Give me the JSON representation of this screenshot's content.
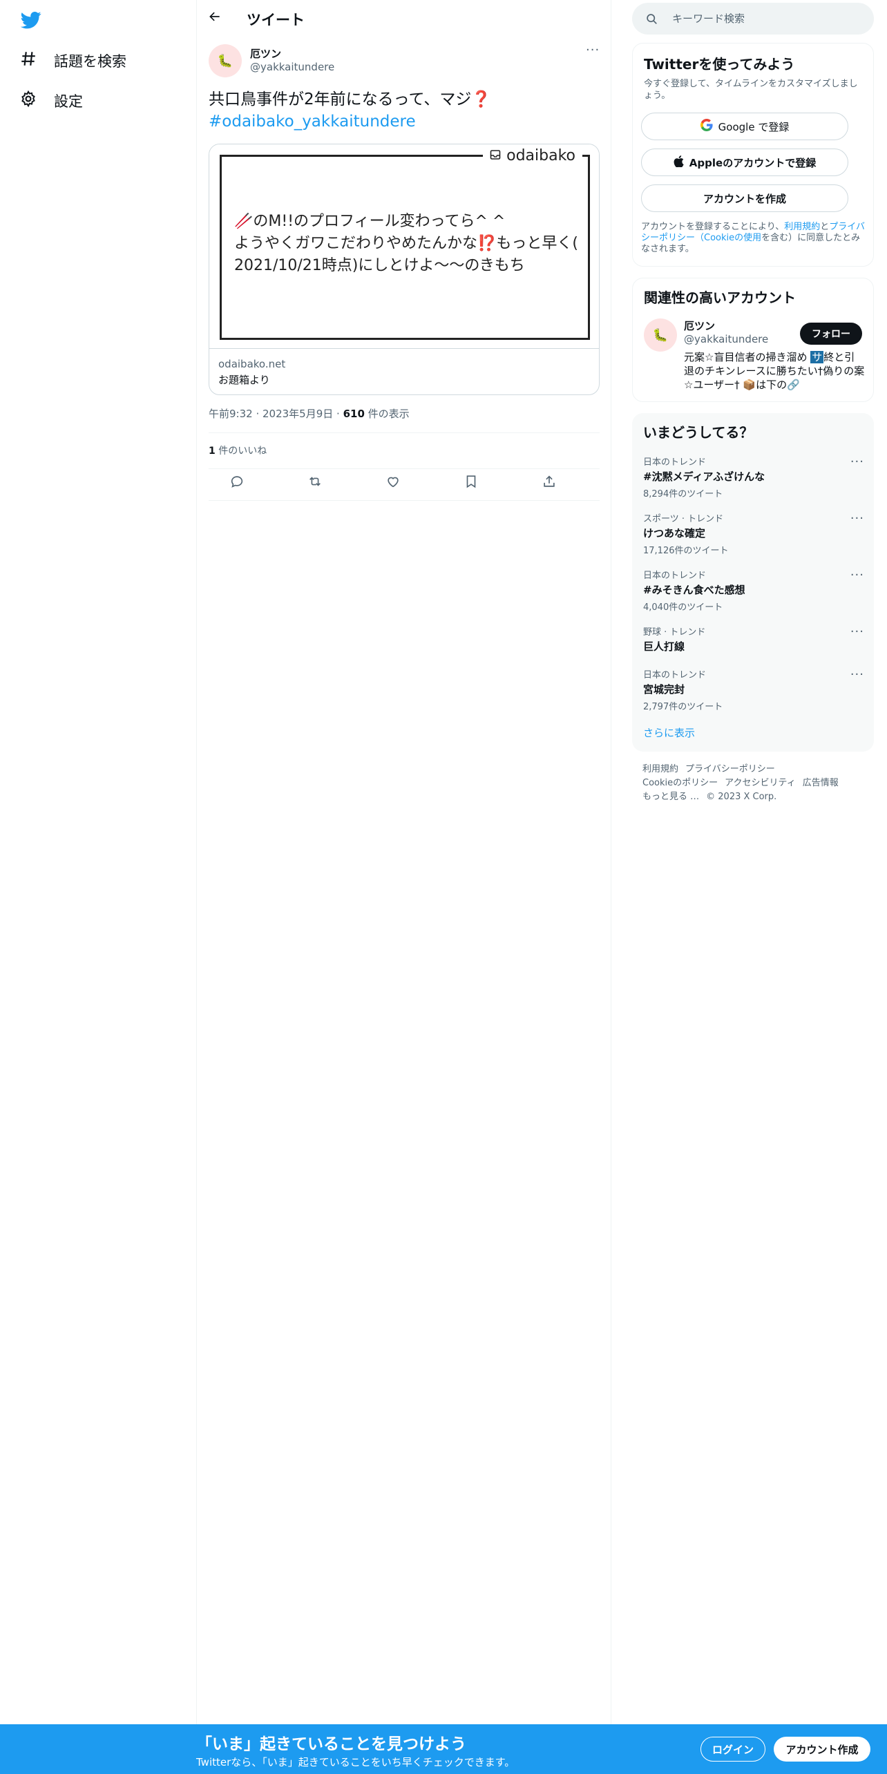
{
  "nav": {
    "items": [
      {
        "label": "話題を検索",
        "icon": "hashtag-icon"
      },
      {
        "label": "設定",
        "icon": "gear-icon"
      }
    ]
  },
  "header": {
    "title": "ツイート"
  },
  "tweet": {
    "author_name": "厄ツン",
    "author_handle": "@yakkaitundere",
    "text": "共口鳥事件が2年前になるって、マジ",
    "text_emoji": "❓",
    "hashtag": "#odaibako_yakkaitundere",
    "card": {
      "brand": "odaibako",
      "message_line1": "🥢のM!!のプロフィール変わってら^ ^",
      "message_line2": "ようやくガワこだわりやめたんかな⁉️もっと早く(",
      "message_line3": "2021/10/21時点)にしとけよ〜〜のきもち",
      "domain": "odaibako.net",
      "title": "お題箱より"
    },
    "time": "午前9:32",
    "date": "2023年5月9日",
    "views_count": "610",
    "views_label": "件の表示",
    "likes_count": "1",
    "likes_label": "件のいいね"
  },
  "search": {
    "placeholder": "キーワード検索"
  },
  "signup": {
    "title": "Twitterを使ってみよう",
    "subtitle": "今すぐ登録して、タイムラインをカスタマイズしましょう。",
    "google_label": "Google で登録",
    "apple_label": "Appleのアカウントで登録",
    "create_label": "アカウントを作成",
    "legal_prefix": "アカウントを登録することにより、",
    "legal_terms": "利用規約",
    "legal_and": "と",
    "legal_privacy": "プライバシーポリシー（Cookieの使用",
    "legal_suffix": "を含む）に同意したとみなされます。"
  },
  "relevant": {
    "title": "関連性の高いアカウント",
    "name": "厄ツン",
    "handle": "@yakkaitundere",
    "follow_label": "フォロー",
    "bio_part1": "元案☆盲目信者の掃き溜め ",
    "bio_tag": "サ",
    "bio_part2": "終と引退のチキンレースに勝ちたい†偽りの案☆ユーザー† 📦は下の🔗"
  },
  "trends": {
    "title": "いまどうしてる？",
    "items": [
      {
        "context": "日本のトレンド",
        "name": "#沈黙メディアふざけんな",
        "count": "8,294件のツイート"
      },
      {
        "context": "スポーツ · トレンド",
        "name": "けつあな確定",
        "count": "17,126件のツイート"
      },
      {
        "context": "日本のトレンド",
        "name": "#みそきん食べた感想",
        "count": "4,040件のツイート"
      },
      {
        "context": "野球 · トレンド",
        "name": "巨人打線",
        "count": ""
      },
      {
        "context": "日本のトレンド",
        "name": "宮城完封",
        "count": "2,797件のツイート"
      }
    ],
    "show_more": "さらに表示"
  },
  "footer": {
    "links": [
      "利用規約",
      "プライバシーポリシー",
      "Cookieのポリシー",
      "アクセシビリティ",
      "広告情報",
      "もっと見る …"
    ],
    "copyright": "© 2023 X Corp."
  },
  "banner": {
    "title": "「いま」起きていることを見つけよう",
    "subtitle": "Twitterなら、「いま」起きていることをいち早くチェックできます。",
    "login_label": "ログイン",
    "create_label": "アカウント作成"
  },
  "colors": {
    "accent": "#1d9bf0",
    "text": "#0f1419",
    "muted": "#536471",
    "border": "#eff3f4"
  }
}
